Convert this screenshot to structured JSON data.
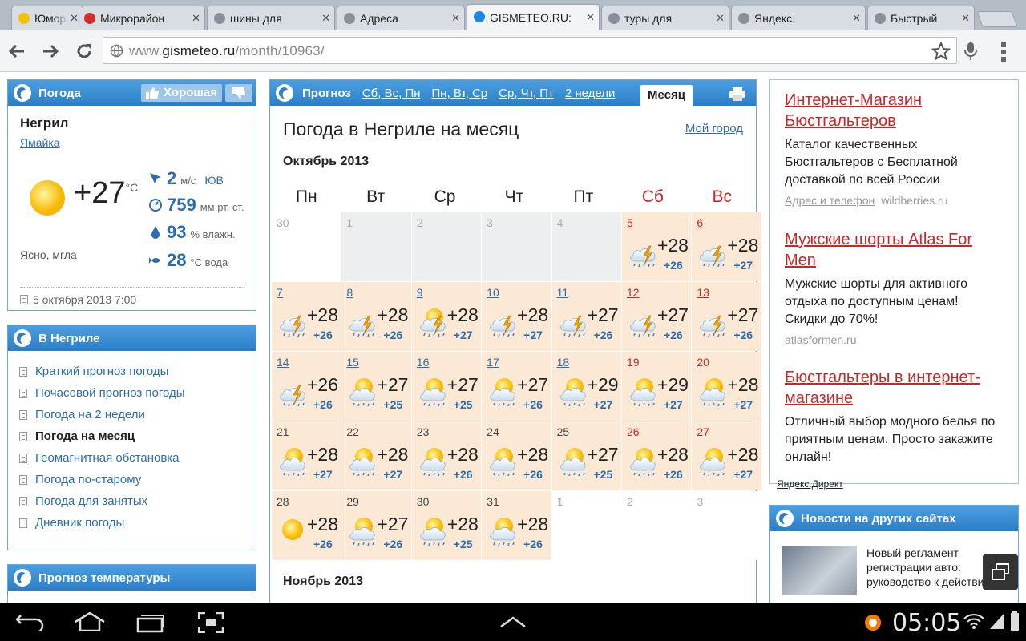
{
  "tabs": [
    {
      "title": "Юмор",
      "active": false
    },
    {
      "title": "Микрорайон",
      "active": false
    },
    {
      "title": "шины для",
      "active": false
    },
    {
      "title": "Адреса",
      "active": false
    },
    {
      "title": "GISMETEO.RU:",
      "active": true
    },
    {
      "title": "туры для",
      "active": false
    },
    {
      "title": "Яндекс.",
      "active": false
    },
    {
      "title": "Быстрый",
      "active": false
    }
  ],
  "address": {
    "prefix": "www.",
    "host": "gismeteo.ru",
    "path": "/month/10963/"
  },
  "left_weather": {
    "header": "Погода",
    "like_label": "Хорошая",
    "city": "Негрил",
    "country": "Ямайка",
    "temp": "+27",
    "temp_unit": "°C",
    "wind_value": "2",
    "wind_unit": "м/с",
    "wind_dir": "ЮВ",
    "pressure_value": "759",
    "pressure_unit": "мм рт. ст.",
    "humidity_value": "93",
    "humidity_unit": "% влажн.",
    "water_value": "28",
    "water_unit": "°С вода",
    "condition": "Ясно, мгла",
    "updated": "5 октября 2013 7:00"
  },
  "left_menu": {
    "header": "В Негриле",
    "items": [
      {
        "label": "Краткий прогноз погоды",
        "current": false
      },
      {
        "label": "Почасовой прогноз погоды",
        "current": false
      },
      {
        "label": "Погода на 2 недели",
        "current": false
      },
      {
        "label": "Погода на месяц",
        "current": true
      },
      {
        "label": "Геомагнитная обстановка",
        "current": false
      },
      {
        "label": "Погода по-старому",
        "current": false
      },
      {
        "label": "Погода для занятых",
        "current": false
      },
      {
        "label": "Дневник погоды",
        "current": false
      }
    ]
  },
  "left_temp": {
    "header": "Прогноз температуры"
  },
  "forecast": {
    "tabs": [
      "Прогноз",
      "Сб, Вс, Пн",
      "Пн, Вт, Ср",
      "Ср, Чт, Пт",
      "2 недели"
    ],
    "active_tab": "Месяц",
    "page_title": "Погода в Негриле на месяц",
    "my_city": "Мой город",
    "month_title": "Октябрь 2013",
    "next_month_title": "Ноябрь 2013",
    "weekdays": [
      "Пн",
      "Вт",
      "Ср",
      "Чт",
      "Пт",
      "Сб",
      "Вс"
    ],
    "days": [
      {
        "d": "30",
        "kind": "empty"
      },
      {
        "d": "1",
        "kind": "past"
      },
      {
        "d": "2",
        "kind": "past"
      },
      {
        "d": "3",
        "kind": "past"
      },
      {
        "d": "4",
        "kind": "past"
      },
      {
        "d": "5",
        "style": "red-link",
        "icon": "storm",
        "hi": "+28",
        "lo": "+26"
      },
      {
        "d": "6",
        "style": "red-link",
        "icon": "storm",
        "hi": "+28",
        "lo": "+27"
      },
      {
        "d": "7",
        "style": "link",
        "icon": "storm",
        "hi": "+28",
        "lo": "+26"
      },
      {
        "d": "8",
        "style": "link",
        "icon": "storm",
        "hi": "+28",
        "lo": "+26"
      },
      {
        "d": "9",
        "style": "link",
        "icon": "storm-sun",
        "hi": "+28",
        "lo": "+27"
      },
      {
        "d": "10",
        "style": "link",
        "icon": "storm",
        "hi": "+28",
        "lo": "+27"
      },
      {
        "d": "11",
        "style": "link",
        "icon": "storm",
        "hi": "+27",
        "lo": "+26"
      },
      {
        "d": "12",
        "style": "red-link",
        "icon": "storm",
        "hi": "+27",
        "lo": "+26"
      },
      {
        "d": "13",
        "style": "red-link",
        "icon": "storm",
        "hi": "+27",
        "lo": "+26"
      },
      {
        "d": "14",
        "style": "link",
        "icon": "storm",
        "hi": "+26",
        "lo": "+26"
      },
      {
        "d": "15",
        "style": "link",
        "icon": "sun-rain",
        "hi": "+27",
        "lo": "+25"
      },
      {
        "d": "16",
        "style": "link",
        "icon": "sun-rain",
        "hi": "+27",
        "lo": "+25"
      },
      {
        "d": "17",
        "style": "link",
        "icon": "sun-rain",
        "hi": "+27",
        "lo": "+26"
      },
      {
        "d": "18",
        "style": "link",
        "icon": "sun-rain",
        "hi": "+29",
        "lo": "+27"
      },
      {
        "d": "19",
        "style": "red",
        "icon": "sun-rain",
        "hi": "+29",
        "lo": "+27"
      },
      {
        "d": "20",
        "style": "red",
        "icon": "sun-rain",
        "hi": "+28",
        "lo": "+27"
      },
      {
        "d": "21",
        "style": "plain",
        "icon": "sun-rain",
        "hi": "+28",
        "lo": "+27"
      },
      {
        "d": "22",
        "style": "plain",
        "icon": "sun-rain",
        "hi": "+28",
        "lo": "+27"
      },
      {
        "d": "23",
        "style": "plain",
        "icon": "sun-rain",
        "hi": "+28",
        "lo": "+26"
      },
      {
        "d": "24",
        "style": "plain",
        "icon": "sun-rain",
        "hi": "+28",
        "lo": "+26"
      },
      {
        "d": "25",
        "style": "plain",
        "icon": "sun-rain",
        "hi": "+27",
        "lo": "+25"
      },
      {
        "d": "26",
        "style": "red",
        "icon": "sun-rain",
        "hi": "+28",
        "lo": "+26"
      },
      {
        "d": "27",
        "style": "red",
        "icon": "sun-rain",
        "hi": "+28",
        "lo": "+27"
      },
      {
        "d": "28",
        "style": "plain",
        "icon": "sun",
        "hi": "+28",
        "lo": "+26"
      },
      {
        "d": "29",
        "style": "plain",
        "icon": "sun-rain",
        "hi": "+27",
        "lo": "+26"
      },
      {
        "d": "30",
        "style": "plain",
        "icon": "sun-rain",
        "hi": "+28",
        "lo": "+25"
      },
      {
        "d": "31",
        "style": "plain",
        "icon": "sun-rain",
        "hi": "+28",
        "lo": "+26"
      },
      {
        "d": "1",
        "kind": "empty"
      },
      {
        "d": "2",
        "kind": "empty"
      },
      {
        "d": "3",
        "kind": "empty"
      }
    ]
  },
  "ads": [
    {
      "title": "Интернет-Магазин Бюстгальтеров",
      "text": "Каталог качественных Бюстгальтеров с Бесплатной доставкой по всей России",
      "link": "Адрес и телефон",
      "url": "wildberries.ru"
    },
    {
      "title": "Мужские шорты Atlas For Men",
      "text": "Мужские шорты для активного отдыха по доступным ценам! Скидки до 70%!",
      "link": "",
      "url": "atlasformen.ru"
    },
    {
      "title": "Бюстгальтеры в интернет-магазине",
      "text": "Отличный выбор модного белья по приятным ценам. Просто закажите онлайн!",
      "link": "",
      "url": ""
    }
  ],
  "yandex_direct": "Яндекс.Директ",
  "news": {
    "header": "Новости на других сайтах",
    "text": "Новый регламент регистрации авто: руководство к действию"
  },
  "system": {
    "clock": "05:05"
  },
  "colors": {
    "accent": "#2c7fc7",
    "weekend": "#c62828",
    "cell": "#fbe9d6"
  }
}
